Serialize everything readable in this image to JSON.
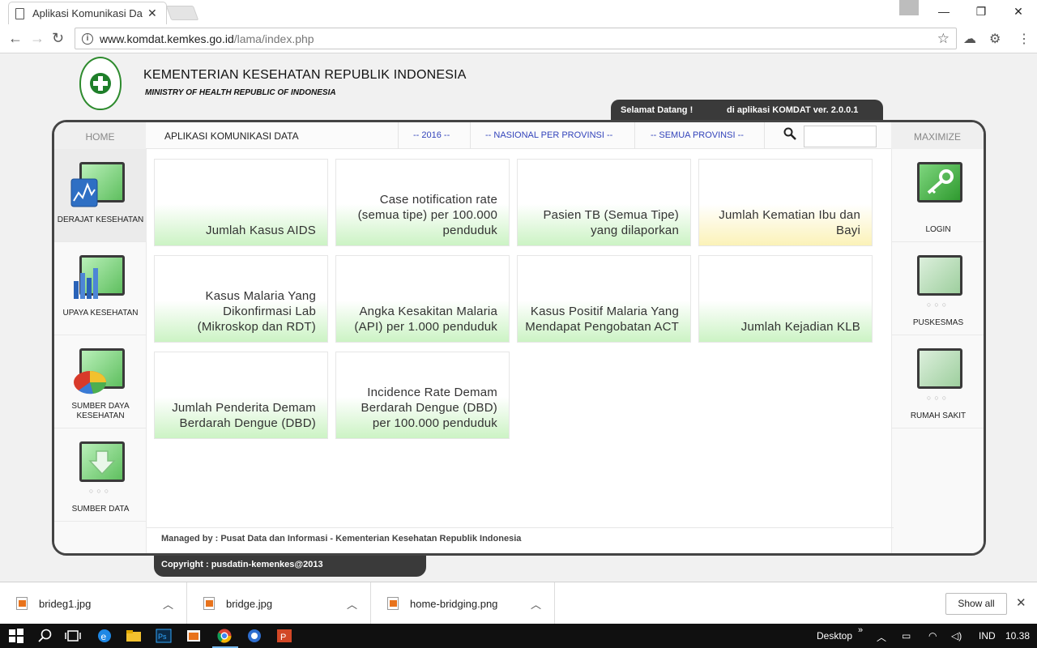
{
  "browser": {
    "tab_title": "Aplikasi Komunikasi Data",
    "tab_close": "✕",
    "url_host": "www.komdat.kemkes.go.id",
    "url_path": "/lama/index.php",
    "win_minimize": "—",
    "win_restore": "❐",
    "win_close": "✕"
  },
  "header": {
    "org_title": "KEMENTERIAN KESEHATAN REPUBLIK INDONESIA",
    "org_subtitle": "MINISTRY OF HEALTH REPUBLIC OF INDONESIA",
    "welcome": "Selamat Datang !",
    "app_version": "di aplikasi KOMDAT ver.  2.0.0.1"
  },
  "topnav": {
    "home": "HOME",
    "app_title": "APLIKASI KOMUNIKASI DATA",
    "year": "-- 2016 --",
    "scope": "-- NASIONAL PER PROVINSI --",
    "province": "-- SEMUA PROVINSI --",
    "search_placeholder": "",
    "maximize": "MAXIMIZE"
  },
  "left_menu": [
    {
      "label": "DERAJAT KESEHATAN",
      "icon": "monitor-chart-icon",
      "active": true
    },
    {
      "label": "UPAYA KESEHATAN",
      "icon": "monitor-bar-chart-icon",
      "active": false
    },
    {
      "label": "SUMBER DAYA KESEHATAN",
      "icon": "monitor-pie-chart-icon",
      "active": false
    },
    {
      "label": "SUMBER DATA",
      "icon": "monitor-download-icon",
      "active": false
    }
  ],
  "right_menu": [
    {
      "label": "LOGIN",
      "icon": "monitor-key-icon"
    },
    {
      "label": "PUSKESMAS",
      "icon": "monitor-icon"
    },
    {
      "label": "RUMAH SAKIT",
      "icon": "monitor-icon"
    }
  ],
  "cards": [
    {
      "text": "Jumlah Kasus AIDS",
      "color": "green"
    },
    {
      "text": "Case notification rate (semua tipe) per 100.000 penduduk",
      "color": "green"
    },
    {
      "text": "Pasien TB (Semua Tipe) yang dilaporkan",
      "color": "green"
    },
    {
      "text": "Jumlah Kematian Ibu dan Bayi",
      "color": "yellow"
    },
    {
      "text": "Kasus Malaria Yang Dikonfirmasi Lab (Mikroskop dan RDT)",
      "color": "green"
    },
    {
      "text": "Angka Kesakitan Malaria (API) per 1.000 penduduk",
      "color": "green"
    },
    {
      "text": "Kasus Positif Malaria Yang Mendapat Pengobatan ACT",
      "color": "green"
    },
    {
      "text": "Jumlah Kejadian KLB",
      "color": "green"
    },
    {
      "text": "Jumlah Penderita Demam Berdarah Dengue (DBD)",
      "color": "green"
    },
    {
      "text": "Incidence Rate Demam Berdarah Dengue (DBD) per 100.000 penduduk",
      "color": "green"
    }
  ],
  "footer": {
    "managed_by": "Managed by : Pusat Data dan Informasi - Kementerian Kesehatan Republik Indonesia",
    "copyright": "Copyright : pusdatin-kemenkes@2013"
  },
  "downloads": [
    {
      "name": "brideg1.jpg"
    },
    {
      "name": "bridge.jpg"
    },
    {
      "name": "home-bridging.png"
    }
  ],
  "downloads_show_all": "Show all",
  "taskbar": {
    "desktop": "Desktop",
    "language": "IND",
    "time": "10.38"
  },
  "colors": {
    "card_green": "#ccf3c4",
    "card_yellow": "#fbf2b8",
    "panel_border": "#444444",
    "accent_blue": "#3344bb"
  }
}
